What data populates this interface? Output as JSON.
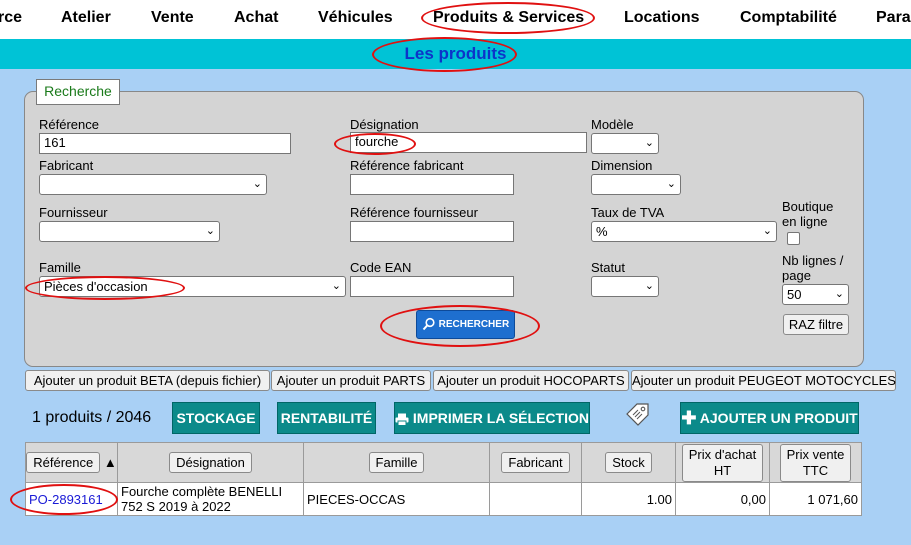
{
  "nav": {
    "items": [
      "rce",
      "Atelier",
      "Vente",
      "Achat",
      "Véhicules",
      "Produits & Services",
      "Locations",
      "Comptabilité",
      "Para"
    ]
  },
  "page_title": "Les produits",
  "search": {
    "tab_label": "Recherche",
    "reference": {
      "label": "Référence",
      "value": "161"
    },
    "designation": {
      "label": "Désignation",
      "value": "fourche"
    },
    "modele": {
      "label": "Modèle",
      "value": ""
    },
    "fabricant": {
      "label": "Fabricant",
      "value": ""
    },
    "ref_fabricant": {
      "label": "Référence fabricant",
      "value": ""
    },
    "dimension": {
      "label": "Dimension",
      "value": ""
    },
    "fournisseur": {
      "label": "Fournisseur",
      "value": ""
    },
    "ref_fournisseur": {
      "label": "Référence fournisseur",
      "value": ""
    },
    "taux_tva": {
      "label": "Taux de TVA",
      "value": "%"
    },
    "boutique": {
      "label_line1": "Boutique",
      "label_line2": "en ligne"
    },
    "famille": {
      "label": "Famille",
      "value": "Pièces d'occasion"
    },
    "code_ean": {
      "label": "Code EAN",
      "value": ""
    },
    "statut": {
      "label": "Statut",
      "value": ""
    },
    "nb_lignes": {
      "label_line1": "Nb lignes /",
      "label_line2": "page",
      "value": "50"
    },
    "search_button": "RECHERCHER",
    "raz_button": "RAZ filtre"
  },
  "add_buttons": [
    "Ajouter un produit BETA (depuis fichier)",
    "Ajouter un produit PARTS",
    "Ajouter un produit HOCOPARTS",
    "Ajouter un produit PEUGEOT MOTOCYCLES"
  ],
  "actions": {
    "count_text": "1 produits / 2046",
    "stockage": "STOCKAGE",
    "rentabilite": "RENTABILITÉ",
    "imprimer": "IMPRIMER LA SÉLECTION",
    "ajouter": "AJOUTER UN PRODUIT"
  },
  "table": {
    "headers": {
      "reference": "Référence",
      "sort_indicator": "▲",
      "designation": "Désignation",
      "famille": "Famille",
      "fabricant": "Fabricant",
      "stock": "Stock",
      "prix_achat_l1": "Prix d'achat",
      "prix_achat_l2": "HT",
      "prix_vente_l1": "Prix vente",
      "prix_vente_l2": "TTC"
    },
    "rows": [
      {
        "reference": "PO-2893161",
        "designation_l1": "Fourche complète BENELLI",
        "designation_l2": "752 S 2019 à 2022",
        "famille": "PIECES-OCCAS",
        "fabricant": "",
        "stock": "1.00",
        "prix_achat": "0,00",
        "prix_vente": "1 071,60"
      }
    ]
  },
  "colors": {
    "nav_bg": "#ffffff",
    "title_bar": "#00c3d6",
    "title_text": "#0d35c9",
    "page_bg": "#a9d0f5",
    "teal_button": "#0b8a8a",
    "blue_button": "#1e6fcf",
    "annotation": "#e01010",
    "link": "#1a1ad6"
  }
}
